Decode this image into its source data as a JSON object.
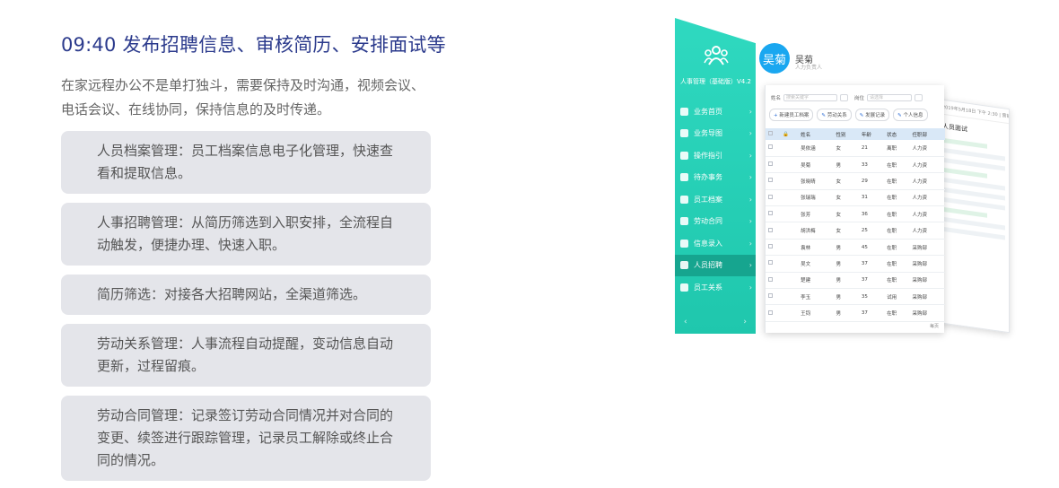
{
  "heading": "09:40 发布招聘信息、审核简历、安排面试等",
  "intro": "在家远程办公不是单打独斗，需要保持及时沟通，视频会议、电话会议、在线协同，保持信息的及时传递。",
  "features": [
    "人员档案管理：员工档案信息电子化管理，快速查看和提取信息。",
    "人事招聘管理：从简历筛选到入职安排，全流程自动触发，便捷办理、快速入职。",
    "简历筛选：对接各大招聘网站，全渠道筛选。",
    "劳动关系管理：人事流程自动提醒，变动信息自动更新，过程留痕。",
    "劳动合同管理：记录签订劳动合同情况并对合同的变更、续签进行跟踪管理，记录员工解除或终止合同的情况。"
  ],
  "app": {
    "name": "人事管理（基础版）V4.2",
    "user_avatar": "吴菊",
    "user_name": "吴菊",
    "user_role": "人力负责人",
    "nav": [
      {
        "label": "业务首页",
        "active": false
      },
      {
        "label": "业务导图",
        "active": false
      },
      {
        "label": "操作指引",
        "active": false
      },
      {
        "label": "待办事务",
        "active": false
      },
      {
        "label": "员工档案",
        "active": false
      },
      {
        "label": "劳动合同",
        "active": false
      },
      {
        "label": "信息录入",
        "active": false
      },
      {
        "label": "人员招聘",
        "active": true
      },
      {
        "label": "员工关系",
        "active": false
      }
    ],
    "pager_prev": "‹",
    "pager_next": "›",
    "filter": {
      "name_label": "姓名",
      "name_placeholder": "搜索关键字",
      "post_label": "岗位",
      "post_placeholder": "请选择"
    },
    "toolbar": [
      "新建员工档案",
      "劳动关系",
      "发展记录",
      "个人信息"
    ],
    "columns": [
      "",
      "",
      "姓名",
      "性别",
      "年龄",
      "状态",
      "任职部"
    ],
    "rows": [
      [
        "吴依涵",
        "女",
        "21",
        "离职",
        "人力资"
      ],
      [
        "吴菊",
        "男",
        "33",
        "在职",
        "人力资"
      ],
      [
        "张晓晴",
        "女",
        "29",
        "在职",
        "人力资"
      ],
      [
        "张瑞瑞",
        "女",
        "31",
        "在职",
        "人力资"
      ],
      [
        "张芳",
        "女",
        "36",
        "在职",
        "人力资"
      ],
      [
        "胡洪梅",
        "女",
        "25",
        "在职",
        "人力资"
      ],
      [
        "袁林",
        "男",
        "45",
        "在职",
        "采购部"
      ],
      [
        "吴文",
        "男",
        "37",
        "在职",
        "采购部"
      ],
      [
        "楚建",
        "男",
        "37",
        "在职",
        "采购部"
      ],
      [
        "李玉",
        "男",
        "35",
        "试用",
        "采购部"
      ],
      [
        "王钧",
        "男",
        "37",
        "在职",
        "采购部"
      ]
    ],
    "footer": "每页",
    "back_title": "人员面试",
    "back_top": "2019年5月18日 下午 2:30 | 营销部-销售经理"
  },
  "colors": {
    "title": "#2b3a8c",
    "sidebar": "#1fc7ad",
    "avatar": "#1aa7f0",
    "card_bg": "#e4e5ea"
  }
}
